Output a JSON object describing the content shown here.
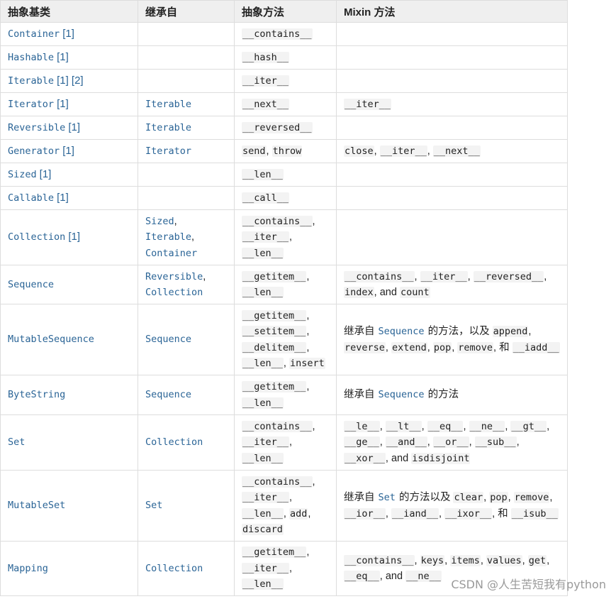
{
  "headers": [
    "抽象基类",
    "继承自",
    "抽象方法",
    "Mixin 方法"
  ],
  "rows": [
    {
      "abc": "Container",
      "ref": "[1]",
      "inherits": [],
      "abstract": [
        "__contains__"
      ],
      "mixin": []
    },
    {
      "abc": "Hashable",
      "ref": "[1]",
      "inherits": [],
      "abstract": [
        "__hash__"
      ],
      "mixin": []
    },
    {
      "abc": "Iterable",
      "ref": "[1] [2]",
      "inherits": [],
      "abstract": [
        "__iter__"
      ],
      "mixin": []
    },
    {
      "abc": "Iterator",
      "ref": "[1]",
      "inherits": [
        "Iterable"
      ],
      "abstract": [
        "__next__"
      ],
      "mixin": [
        "__iter__"
      ]
    },
    {
      "abc": "Reversible",
      "ref": "[1]",
      "inherits": [
        "Iterable"
      ],
      "abstract": [
        "__reversed__"
      ],
      "mixin": []
    },
    {
      "abc": "Generator",
      "ref": "[1]",
      "inherits": [
        "Iterator"
      ],
      "abstract": [
        "send",
        "throw"
      ],
      "mixin": [
        "close",
        "__iter__",
        "__next__"
      ]
    },
    {
      "abc": "Sized",
      "ref": "[1]",
      "inherits": [],
      "abstract": [
        "__len__"
      ],
      "mixin": []
    },
    {
      "abc": "Callable",
      "ref": "[1]",
      "inherits": [],
      "abstract": [
        "__call__"
      ],
      "mixin": []
    },
    {
      "abc": "Collection",
      "ref": "[1]",
      "inherits": [
        "Sized",
        "Iterable",
        "Container"
      ],
      "abstract": [
        "__contains__",
        "__iter__",
        "__len__"
      ],
      "mixin": []
    },
    {
      "abc": "Sequence",
      "ref": "",
      "inherits": [
        "Reversible",
        "Collection"
      ],
      "abstract": [
        "__getitem__",
        "__len__"
      ],
      "mixin": [
        "__contains__",
        "__iter__",
        "__reversed__",
        "index",
        "count"
      ],
      "mixin_joiner": "and"
    },
    {
      "abc": "MutableSequence",
      "ref": "",
      "inherits": [
        "Sequence"
      ],
      "abstract": [
        "__getitem__",
        "__setitem__",
        "__delitem__",
        "__len__",
        "insert"
      ],
      "mixin_prefix": "继承自",
      "mixin_link": "Sequence",
      "mixin_middle": "的方法，以及",
      "mixin": [
        "append",
        "reverse",
        "extend",
        "pop",
        "remove",
        "__iadd__"
      ],
      "mixin_joiner": "和"
    },
    {
      "abc": "ByteString",
      "ref": "",
      "inherits": [
        "Sequence"
      ],
      "abstract": [
        "__getitem__",
        "__len__"
      ],
      "mixin_prefix": "继承自",
      "mixin_link": "Sequence",
      "mixin_middle": "的方法",
      "mixin": []
    },
    {
      "abc": "Set",
      "ref": "",
      "inherits": [
        "Collection"
      ],
      "abstract": [
        "__contains__",
        "__iter__",
        "__len__"
      ],
      "mixin": [
        "__le__",
        "__lt__",
        "__eq__",
        "__ne__",
        "__gt__",
        "__ge__",
        "__and__",
        "__or__",
        "__sub__",
        "__xor__",
        "isdisjoint"
      ],
      "mixin_joiner": "and"
    },
    {
      "abc": "MutableSet",
      "ref": "",
      "inherits": [
        "Set"
      ],
      "abstract": [
        "__contains__",
        "__iter__",
        "__len__",
        "add",
        "discard"
      ],
      "mixin_prefix": "继承自",
      "mixin_link": "Set",
      "mixin_middle": "的方法以及",
      "mixin": [
        "clear",
        "pop",
        "remove",
        "__ior__",
        "__iand__",
        "__ixor__",
        "__isub__"
      ],
      "mixin_joiner": "和"
    },
    {
      "abc": "Mapping",
      "ref": "",
      "inherits": [
        "Collection"
      ],
      "abstract": [
        "__getitem__",
        "__iter__",
        "__len__"
      ],
      "mixin": [
        "__contains__",
        "keys",
        "items",
        "values",
        "get",
        "__eq__",
        "__ne__"
      ],
      "mixin_joiner": "and"
    }
  ],
  "watermark": "CSDN @人生苦短我有python",
  "colors": {
    "link": "#2a6496",
    "header_bg": "#efefef",
    "border": "#dddddd",
    "code_bg": "#f3f3f3"
  }
}
